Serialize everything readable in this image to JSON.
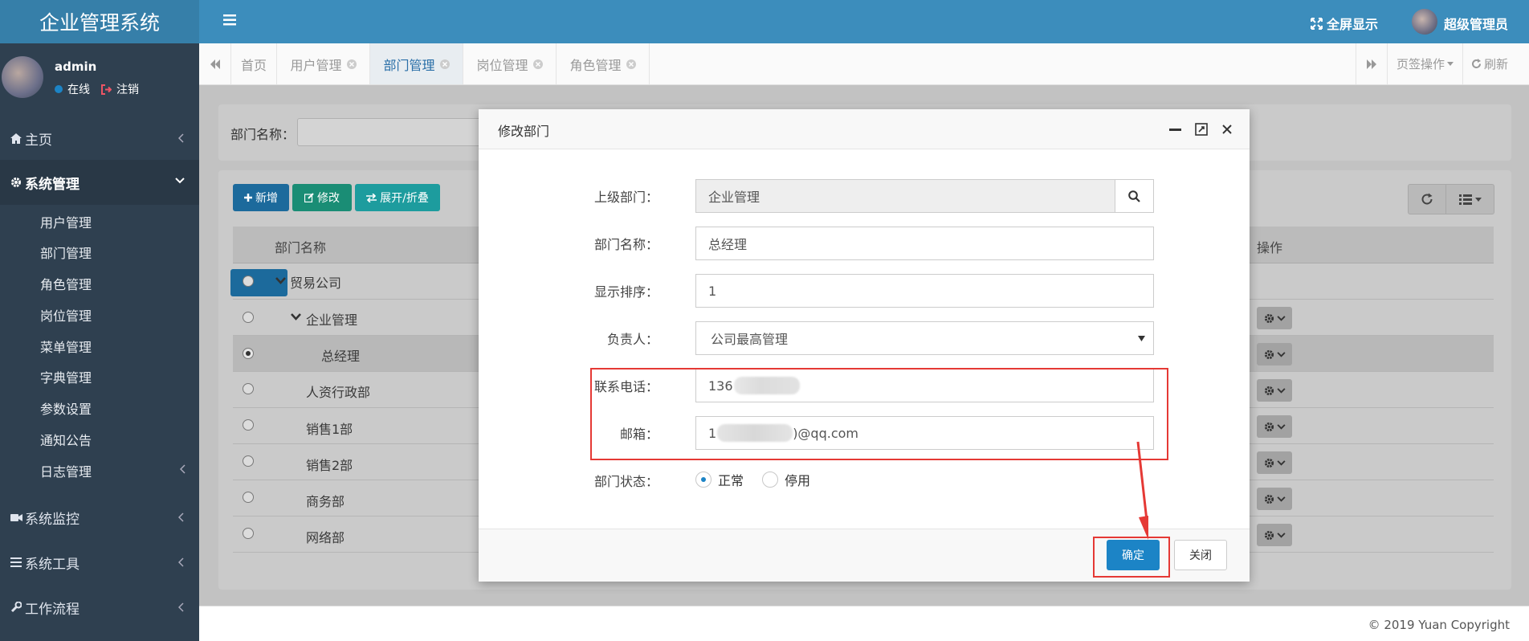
{
  "app": {
    "title": "企业管理系统"
  },
  "header": {
    "fullscreen": "全屏显示",
    "user": "超级管理员"
  },
  "user_panel": {
    "name": "admin",
    "online": "在线",
    "logout": "注销"
  },
  "sidebar": {
    "home": "主页",
    "system": "系统管理",
    "system_items": [
      "用户管理",
      "部门管理",
      "角色管理",
      "岗位管理",
      "菜单管理",
      "字典管理",
      "参数设置",
      "通知公告",
      "日志管理"
    ],
    "monitor": "系统监控",
    "tools": "系统工具",
    "workflow": "工作流程"
  },
  "tabs": [
    "首页",
    "用户管理",
    "部门管理",
    "岗位管理",
    "角色管理"
  ],
  "tab_actions": {
    "page_ops": "页签操作",
    "refresh": "刷新"
  },
  "search": {
    "label": "部门名称："
  },
  "toolbar": {
    "add": "新增",
    "edit": "修改",
    "toggle": "展开/折叠"
  },
  "table": {
    "col_name": "部门名称",
    "col_ops": "操作",
    "rows": [
      "贸易公司",
      "企业管理",
      "总经理",
      "人资行政部",
      "销售1部",
      "销售2部",
      "商务部",
      "网络部"
    ]
  },
  "modal": {
    "title": "修改部门",
    "labels": {
      "parent": "上级部门：",
      "name": "部门名称：",
      "order": "显示排序：",
      "leader": "负责人：",
      "phone": "联系电话：",
      "email": "邮箱：",
      "status": "部门状态："
    },
    "values": {
      "parent": "企业管理",
      "name": "总经理",
      "order": "1",
      "leader": "公司最高管理",
      "phone_visible": "136",
      "email_prefix": "1",
      "email_suffix": ")@qq.com"
    },
    "status_options": {
      "normal": "正常",
      "disabled": "停用"
    },
    "confirm": "确定",
    "close": "关闭"
  },
  "footer": {
    "copyright": "© 2019 Yuan Copyright"
  },
  "colors": {
    "sidebar": "#2f4050",
    "header": "#3c8dbc",
    "primary": "#1c84c6",
    "edit": "#1ab394",
    "teal": "#23c6c8",
    "highlight": "#e53935"
  }
}
